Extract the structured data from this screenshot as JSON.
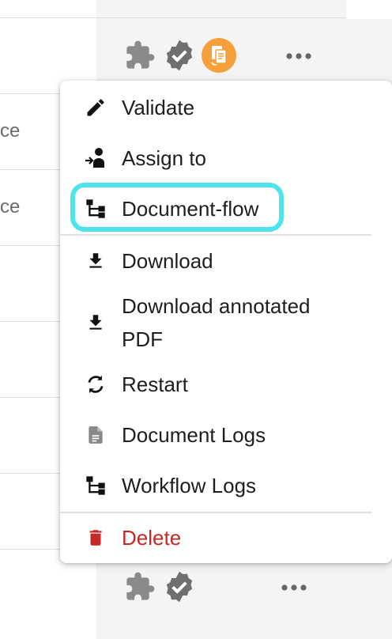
{
  "background": {
    "rows": [
      {
        "text": "ce"
      },
      {
        "text": "ce"
      }
    ]
  },
  "menu": {
    "items": [
      {
        "label": "Validate",
        "icon": "pencil-icon"
      },
      {
        "label": "Assign to",
        "icon": "assign-person-icon"
      },
      {
        "label": "Document-flow",
        "icon": "flow-tree-icon"
      },
      {
        "label": "Download",
        "icon": "download-icon"
      },
      {
        "label": "Download annotated",
        "label2": "PDF",
        "icon": "download-icon"
      },
      {
        "label": "Restart",
        "icon": "restart-icon"
      },
      {
        "label": "Document Logs",
        "icon": "document-icon"
      },
      {
        "label": "Workflow Logs",
        "icon": "flow-tree-icon"
      },
      {
        "label": "Delete",
        "icon": "trash-icon"
      }
    ]
  },
  "colors": {
    "delete": "#c62828",
    "focus_ring": "#4fe3ee",
    "badge_orange": "#f5a03a",
    "icon_gray": "#777777"
  }
}
